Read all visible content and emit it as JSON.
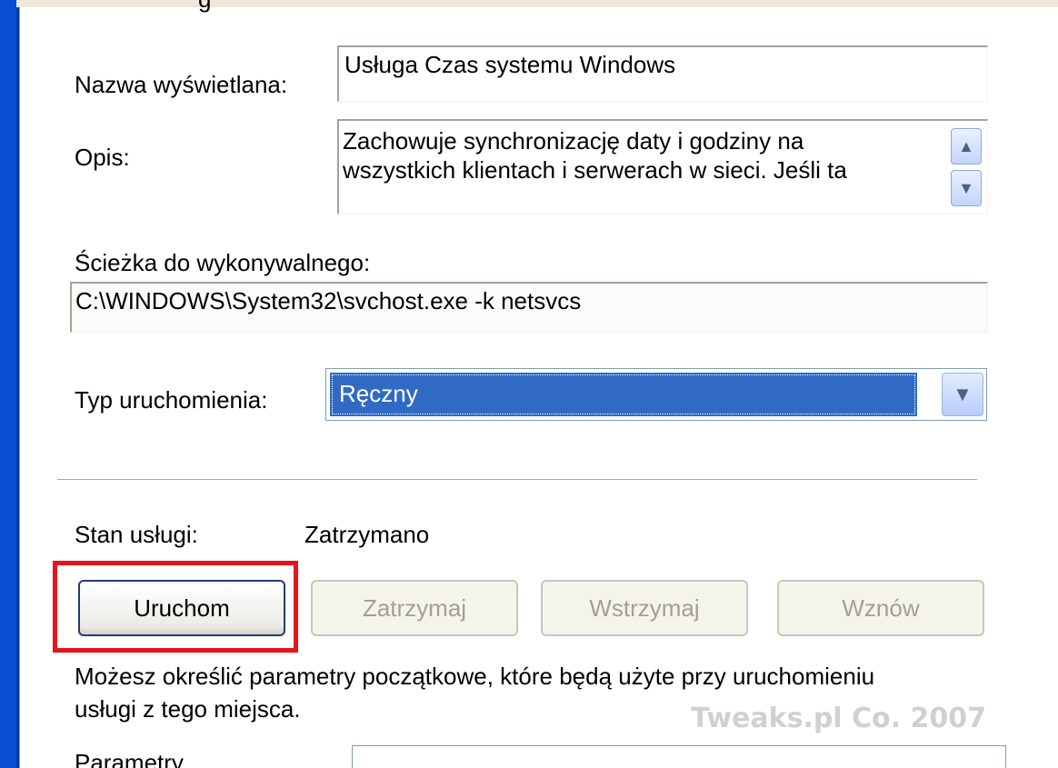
{
  "dialog": {
    "cut_top_label": "g",
    "display_name": {
      "label": "Nazwa wyświetlana:",
      "value": "Usługa Czas systemu Windows"
    },
    "description": {
      "label": "Opis:",
      "value": "Zachowuje synchronizację daty i godziny na\nwszystkich klientach i serwerach w sieci. Jeśli ta"
    },
    "executable_path": {
      "label": "Ścieżka do wykonywalnego:",
      "value": "C:\\WINDOWS\\System32\\svchost.exe -k netsvcs"
    },
    "startup_type": {
      "label": "Typ uruchomienia:",
      "selected": "Ręczny"
    },
    "service_status": {
      "label": "Stan usługi:",
      "value": "Zatrzymano"
    },
    "buttons": {
      "start": "Uruchom",
      "stop": "Zatrzymaj",
      "pause": "Wstrzymaj",
      "resume": "Wznów"
    },
    "params_info": "Możesz określić parametry początkowe, które będą użyte przy uruchomieniu\nusługi z tego miejsca.",
    "params_label": "Parametry",
    "watermark": "Tweaks.pl Co. 2007"
  },
  "icons": {
    "scroll_up": "chevron-up-icon",
    "scroll_down": "chevron-down-icon",
    "dropdown": "chevron-down-icon"
  },
  "colors": {
    "selection": "#316ac5",
    "highlight_box": "#e8141b",
    "disabled_text": "#a19f96"
  }
}
